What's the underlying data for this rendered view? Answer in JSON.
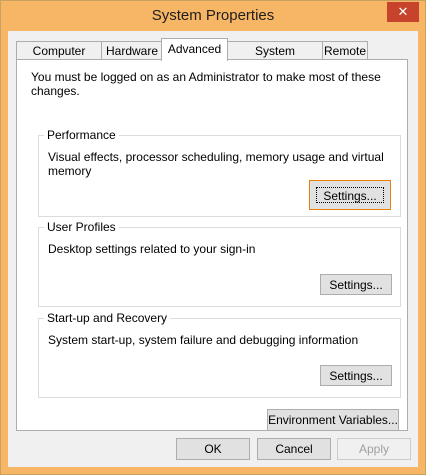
{
  "window": {
    "title": "System Properties",
    "close_glyph": "✕"
  },
  "tabs": [
    {
      "label": "Computer Name",
      "active": false
    },
    {
      "label": "Hardware",
      "active": false
    },
    {
      "label": "Advanced",
      "active": true
    },
    {
      "label": "System Protection",
      "active": false
    },
    {
      "label": "Remote",
      "active": false
    }
  ],
  "advanced": {
    "intro": "You must be logged on as an Administrator to make most of these changes.",
    "performance": {
      "label": "Performance",
      "description": "Visual effects, processor scheduling, memory usage and virtual memory",
      "button": "Settings..."
    },
    "user_profiles": {
      "label": "User Profiles",
      "description": "Desktop settings related to your sign-in",
      "button": "Settings..."
    },
    "startup_recovery": {
      "label": "Start-up and Recovery",
      "description": "System start-up, system failure and debugging information",
      "button": "Settings..."
    },
    "env_button": "Environment Variables..."
  },
  "footer": {
    "ok": "OK",
    "cancel": "Cancel",
    "apply": "Apply"
  },
  "colors": {
    "frame_accent": "#f6b665",
    "close_button": "#c7432c",
    "focus_border": "#e8820a"
  }
}
